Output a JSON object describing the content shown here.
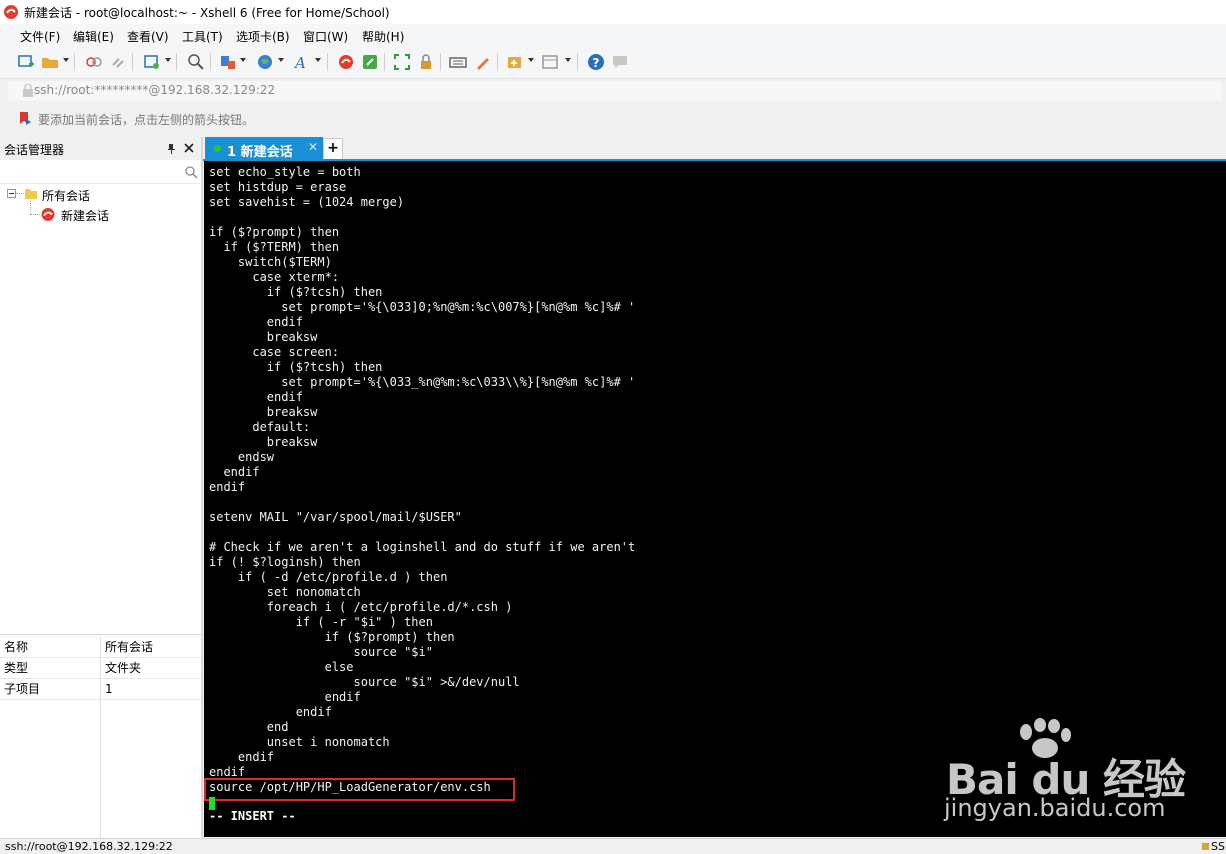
{
  "window": {
    "title": "新建会话 - root@localhost:~ - Xshell 6 (Free for Home/School)"
  },
  "menu": [
    {
      "label": "文件(F)"
    },
    {
      "label": "编辑(E)"
    },
    {
      "label": "查看(V)"
    },
    {
      "label": "工具(T)"
    },
    {
      "label": "选项卡(B)"
    },
    {
      "label": "窗口(W)"
    },
    {
      "label": "帮助(H)"
    }
  ],
  "address": {
    "value": "ssh://root:*********@192.168.32.129:22"
  },
  "hint": {
    "text": "要添加当前会话，点击左侧的箭头按钮。"
  },
  "session_manager": {
    "title": "会话管理器",
    "pin_icon": "pin-icon",
    "tree": {
      "root": "所有会话",
      "child": "新建会话"
    },
    "properties": [
      {
        "name": "名称",
        "value": "所有会话"
      },
      {
        "name": "类型",
        "value": "文件夹"
      },
      {
        "name": "子项目",
        "value": "1"
      }
    ]
  },
  "tabs": [
    {
      "label": "1 新建会话",
      "status_color": "#22cc22"
    }
  ],
  "terminal": {
    "lines": "set echo_style = both\nset histdup = erase\nset savehist = (1024 merge)\n\nif ($?prompt) then\n  if ($?TERM) then\n    switch($TERM)\n      case xterm*:\n        if ($?tcsh) then\n          set prompt='%{\\033]0;%n@%m:%c\\007%}[%n@%m %c]%# '\n        endif\n        breaksw\n      case screen:\n        if ($?tcsh) then\n          set prompt='%{\\033_%n@%m:%c\\033\\\\%}[%n@%m %c]%# '\n        endif\n        breaksw\n      default:\n        breaksw\n    endsw\n  endif\nendif\n\nsetenv MAIL \"/var/spool/mail/$USER\"\n\n# Check if we aren't a loginshell and do stuff if we aren't\nif (! $?loginsh) then\n    if ( -d /etc/profile.d ) then\n        set nonomatch\n        foreach i ( /etc/profile.d/*.csh )\n            if ( -r \"$i\" ) then\n                if ($?prompt) then\n                    source \"$i\"\n                else\n                    source \"$i\" >&/dev/null\n                endif\n            endif\n        end\n        unset i nonomatch\n    endif\nendif\nsource /opt/HP/HP_LoadGenerator/env.csh",
    "mode": "-- INSERT --"
  },
  "watermark": {
    "brand": "Bai du 经验",
    "url": "jingyan.baidu.com"
  },
  "status": {
    "connection": "ssh://root@192.168.32.129:22",
    "right": "SS"
  },
  "colors": {
    "accent": "#1a8fd6",
    "terminal_bg": "#000000",
    "highlight": "#e0262a",
    "cursor": "#1ee01e"
  }
}
